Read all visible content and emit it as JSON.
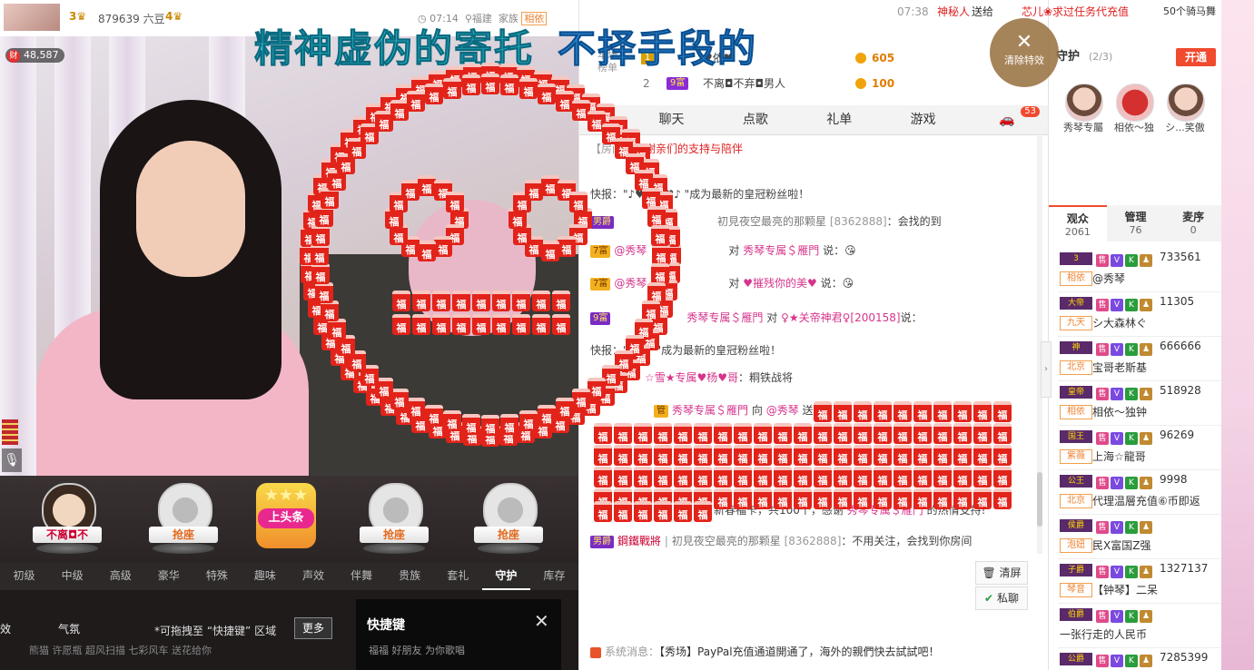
{
  "topbar": {
    "level_left": "3",
    "count": "879639 六豆",
    "level_right": "4",
    "time": "07:14",
    "location": "福建",
    "group": "家族",
    "fan_tag": "相依"
  },
  "video": {
    "fortune_label": "财",
    "fortune_value": "48,587",
    "mic_icon": "microphone-icon"
  },
  "caption": {
    "part1": "精神虚伪的寄托",
    "part2": "不择手段的"
  },
  "seats": [
    {
      "label": "不离◘不"
    },
    {
      "label": "抢座"
    },
    {
      "label": "抢座"
    },
    {
      "label": "抢座"
    }
  ],
  "headline": {
    "label": "上头条"
  },
  "gift_tabs": [
    "初级",
    "中级",
    "高级",
    "豪华",
    "特殊",
    "趣味",
    "声效",
    "伴舞",
    "贵族",
    "套礼",
    "守护",
    "库存"
  ],
  "gift_tabs_active": "守护",
  "giftbox": {
    "left_label": "效",
    "qi_label": "气氛",
    "hint": "*可拖拽至 “快捷键” 区域",
    "more": "更多",
    "names": "熊猫  许愿瓶  超风扫描  七彩风车  送花给你"
  },
  "shortcut": {
    "title": "快捷键",
    "names": "福福  好朋友  为你歌唱"
  },
  "mid": {
    "top_time": "07:38",
    "top_user": "神秘人",
    "top_verb": "送给",
    "top_target": "芯儿❀求过任务代充值",
    "top_gift": "50个骑马舞",
    "rank_label1": "本场",
    "rank_label2": "榜单",
    "rank": [
      {
        "no": "1",
        "badge": "",
        "name": "♥依♥",
        "value": "605"
      },
      {
        "no": "2",
        "badge": "9富",
        "name": "不离◘不弃◘男人",
        "value": "100"
      }
    ],
    "tabs": [
      "聊天",
      "点歌",
      "礼单",
      "游戏"
    ],
    "car_count": "53",
    "messages": [
      {
        "t1": "【房间】",
        "t2": "感谢亲们的支持与陪伴",
        "kind": "room"
      },
      {
        "t1": "快报：\"♪♥♥♥♥♪ \"成为最新的皇冠粉丝啦！",
        "kind": "flash"
      },
      {
        "badge": "男爵",
        "user": "初見夜空最亮的那颗星",
        "id": "[8362888]",
        "text": "：会找的到",
        "kind": "chat"
      },
      {
        "badge": "7富",
        "user": "@秀琴",
        "mid": "对",
        "target": "秀琴专属＄雁門",
        "text": "说：😘",
        "kind": "chat2"
      },
      {
        "badge": "7富",
        "user": "@秀琴",
        "mid": "对",
        "target": "♥摧残你的美♥",
        "text": "说：😘",
        "kind": "chat2"
      },
      {
        "badge": "9富",
        "user": "秀琴专属＄雁門",
        "mid": "对",
        "target": "♀★关帝神君♀[200158]",
        "text": "说：",
        "kind": "chat2"
      },
      {
        "t1": "快报：\"♪梦♪ \"成为最新的皇冠粉丝啦！",
        "kind": "flash"
      },
      {
        "user": "☆雪★专属♥杨♥哥",
        "text": "：粡铁战将",
        "kind": "plain"
      },
      {
        "badge": "管",
        "user": "秀琴专属＄雁門",
        "mid": "向",
        "target": "@秀琴",
        "text": "送",
        "kind": "chat2"
      },
      {
        "t1": "新春福卡，共100个，感谢",
        "target": "秀琴专属＄雁門",
        "t2": "的热情支持!",
        "kind": "thanks"
      },
      {
        "badge": "男爵",
        "user2": "鋼鐵戰將",
        "user": "初見夜空最亮的那颗星",
        "id": "[8362888]",
        "text": "：不用关注，会找到你房间",
        "kind": "chat"
      }
    ],
    "clear_btn": "清屏",
    "private_btn": "私聊",
    "sys_label": "系统消息：",
    "sys_text": "【秀场】PayPal充值通道開通了，海外的親們快去試試吧！"
  },
  "right": {
    "clear_fx": "清除特效",
    "guard_title": "守护",
    "guard_count": "(2/3)",
    "open_btn": "开通",
    "guards": [
      "秀琴专屬",
      "相依～独",
      "シ...笑傲"
    ],
    "tabs": [
      {
        "label": "观众",
        "value": "2061"
      },
      {
        "label": "管理",
        "value": "76"
      },
      {
        "label": "麦序",
        "value": "0"
      }
    ],
    "viewers": [
      {
        "badge": "3",
        "num": "733561",
        "fan": "相依",
        "name": "@秀琴"
      },
      {
        "badge": "大帝",
        "num": "11305",
        "fan": "九天",
        "name": "シ大森林ぐ"
      },
      {
        "badge": "神",
        "num": "666666",
        "fan": "北京",
        "name": "宝哥老斯基"
      },
      {
        "badge": "皇帝",
        "num": "518928",
        "fan": "相依",
        "name": "相依～独钟"
      },
      {
        "badge": "国王",
        "num": "96269",
        "fan": "紫薇",
        "name": "上海☆龍哥"
      },
      {
        "badge": "公王",
        "num": "9998",
        "fan": "北京",
        "name": "代理温層充值⑥币即返"
      },
      {
        "badge": "侯爵",
        "num": "",
        "fan": "泡妞",
        "name": "民X富国Z强"
      },
      {
        "badge": "子爵",
        "num": "1327137",
        "fan": "琴音",
        "name": "【钟琴】二呆"
      },
      {
        "badge": "伯爵",
        "num": "",
        "fan": "",
        "name": "一张行走的人民币"
      },
      {
        "badge": "公爵",
        "num": "7285399",
        "fan": "",
        "name": ""
      }
    ]
  },
  "colors": {
    "accent": "#f04a2f",
    "gold": "#e07c00",
    "fu_red": "#e2231a"
  }
}
